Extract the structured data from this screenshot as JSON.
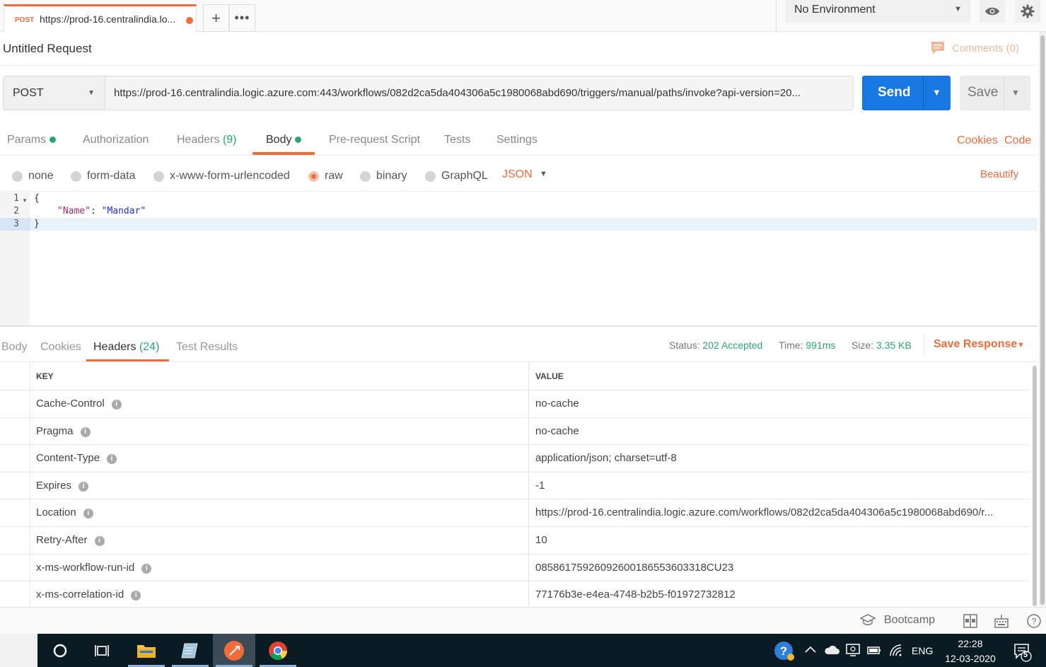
{
  "tab": {
    "method": "POST",
    "url_short": "https://prod-16.centralindia.lo..."
  },
  "environment": {
    "selected": "No Environment"
  },
  "request": {
    "title": "Untitled Request",
    "comments_label": "Comments (0)",
    "method": "POST",
    "url": "https://prod-16.centralindia.logic.azure.com:443/workflows/082d2ca5da404306a5c1980068abd690/triggers/manual/paths/invoke?api-version=20...",
    "send_label": "Send",
    "save_label": "Save"
  },
  "request_tabs": {
    "params": "Params",
    "authorization": "Authorization",
    "headers": "Headers",
    "headers_count": "(9)",
    "body": "Body",
    "pre_request": "Pre-request Script",
    "tests": "Tests",
    "settings": "Settings",
    "cookies": "Cookies",
    "code": "Code"
  },
  "body_types": {
    "none": "none",
    "form_data": "form-data",
    "urlencoded": "x-www-form-urlencoded",
    "raw": "raw",
    "binary": "binary",
    "graphql": "GraphQL",
    "selected": "raw",
    "language": "JSON",
    "beautify": "Beautify"
  },
  "editor": {
    "line_numbers": [
      "1",
      "2",
      "3"
    ],
    "line1": "{",
    "line2_key": "\"Name\"",
    "line2_sep": ": ",
    "line2_value": "\"Mandar\"",
    "line3": "}"
  },
  "response": {
    "tabs": {
      "body": "Body",
      "cookies": "Cookies",
      "headers": "Headers",
      "headers_count": "(24)",
      "test_results": "Test Results"
    },
    "status_label": "Status:",
    "status_value": "202 Accepted",
    "time_label": "Time:",
    "time_value": "991ms",
    "size_label": "Size:",
    "size_value": "3.35 KB",
    "save_response": "Save Response",
    "columns": {
      "key": "KEY",
      "value": "VALUE"
    },
    "headers": [
      {
        "key": "Cache-Control",
        "value": "no-cache"
      },
      {
        "key": "Pragma",
        "value": "no-cache"
      },
      {
        "key": "Content-Type",
        "value": "application/json; charset=utf-8"
      },
      {
        "key": "Expires",
        "value": "-1"
      },
      {
        "key": "Location",
        "value": "https://prod-16.centralindia.logic.azure.com/workflows/082d2ca5da404306a5c1980068abd690/r..."
      },
      {
        "key": "Retry-After",
        "value": "10"
      },
      {
        "key": "x-ms-workflow-run-id",
        "value": "08586175926092600186553603318CU23"
      },
      {
        "key": "x-ms-correlation-id",
        "value": "77176b3e-e4ea-4748-b2b5-f01972732812"
      }
    ]
  },
  "footer": {
    "bootcamp": "Bootcamp"
  },
  "taskbar": {
    "language": "ENG",
    "time": "22:28",
    "date": "12-03-2020",
    "notification_count": "5"
  },
  "colors": {
    "accent": "#f26b3a",
    "send_blue": "#1678e0",
    "success_green": "#2aa57a"
  }
}
